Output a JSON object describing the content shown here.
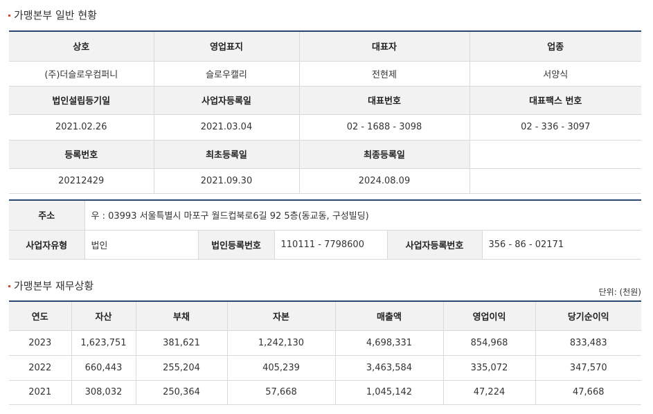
{
  "general": {
    "title": "가맹본부 일반 현황",
    "headers1": [
      "상호",
      "영업표지",
      "대표자",
      "업종"
    ],
    "values1": [
      "(주)더슬로우컴퍼니",
      "슬로우캘리",
      "전현제",
      "서양식"
    ],
    "headers2": [
      "법인설립등기일",
      "사업자등록일",
      "대표번호",
      "대표팩스 번호"
    ],
    "values2": [
      "2021.02.26",
      "2021.03.04",
      "02 - 1688 - 3098",
      "02 - 336 - 3097"
    ],
    "headers3": [
      "등록번호",
      "최초등록일",
      "최종등록일",
      ""
    ],
    "values3": [
      "20212429",
      "2021.09.30",
      "2024.08.09",
      ""
    ]
  },
  "address": {
    "label": "주소",
    "value": "우 : 03993 서울특별시 마포구 월드컵북로6길 92 5층(동교동, 구성빌딩)",
    "biz_type_label": "사업자유형",
    "biz_type_value": "법인",
    "corp_no_label": "법인등록번호",
    "corp_no_value": "110111 - 7798600",
    "biz_no_label": "사업자등록번호",
    "biz_no_value": "356 - 86 - 02171"
  },
  "finance": {
    "title": "가맹본부 재무상황",
    "unit": "단위: (천원)",
    "headers": [
      "연도",
      "자산",
      "부채",
      "자본",
      "매출액",
      "영업이익",
      "당기순이익"
    ],
    "rows": [
      [
        "2023",
        "1,623,751",
        "381,621",
        "1,242,130",
        "4,698,331",
        "854,968",
        "833,483"
      ],
      [
        "2022",
        "660,443",
        "255,204",
        "405,239",
        "3,463,584",
        "335,072",
        "347,570"
      ],
      [
        "2021",
        "308,032",
        "250,364",
        "57,668",
        "1,045,142",
        "47,224",
        "47,668"
      ]
    ]
  }
}
